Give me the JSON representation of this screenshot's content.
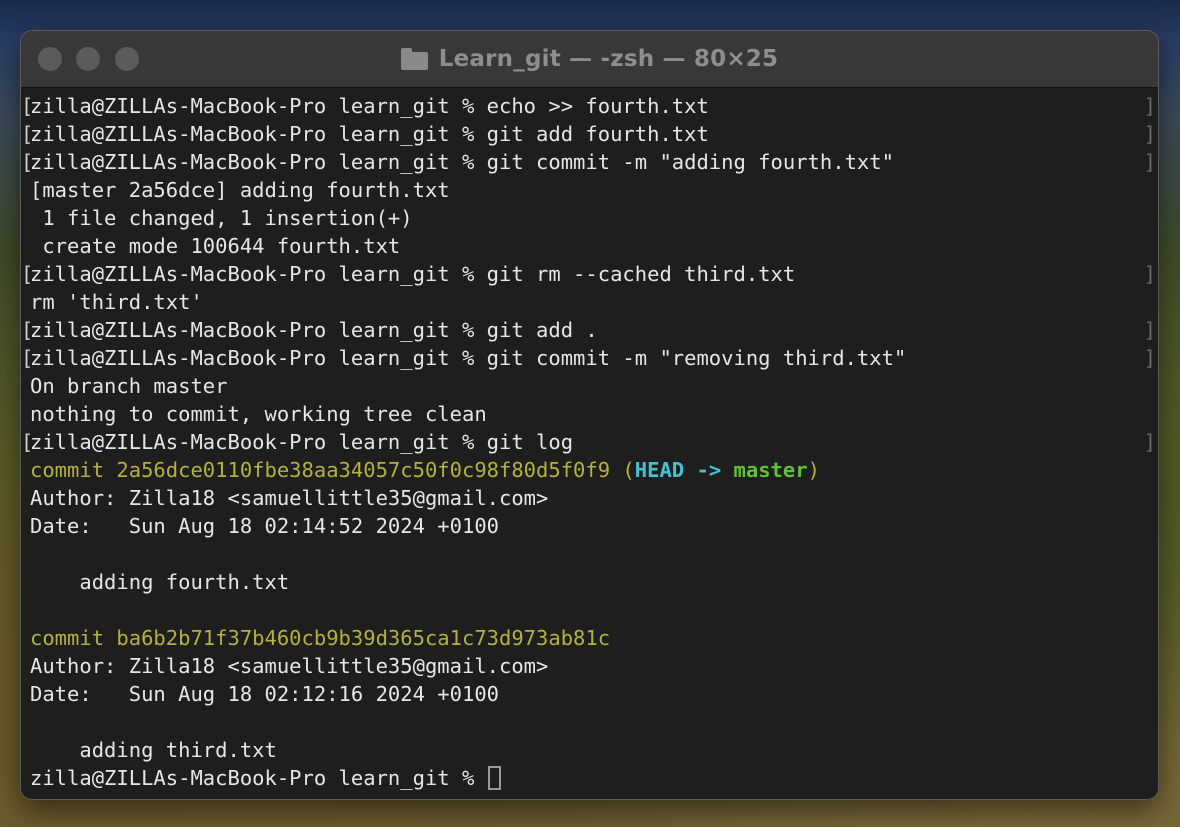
{
  "window": {
    "title": "Learn_git — -zsh — 80×25"
  },
  "terminal": {
    "lines": [
      {
        "kind": "prompt",
        "text": "zilla@ZILLAs-MacBook-Pro learn_git % echo >> fourth.txt"
      },
      {
        "kind": "prompt",
        "text": "zilla@ZILLAs-MacBook-Pro learn_git % git add fourth.txt"
      },
      {
        "kind": "prompt",
        "text": "zilla@ZILLAs-MacBook-Pro learn_git % git commit -m \"adding fourth.txt\""
      },
      {
        "kind": "output",
        "text": "[master 2a56dce] adding fourth.txt"
      },
      {
        "kind": "output",
        "text": " 1 file changed, 1 insertion(+)"
      },
      {
        "kind": "output",
        "text": " create mode 100644 fourth.txt"
      },
      {
        "kind": "prompt",
        "text": "zilla@ZILLAs-MacBook-Pro learn_git % git rm --cached third.txt"
      },
      {
        "kind": "output",
        "text": "rm 'third.txt'"
      },
      {
        "kind": "prompt",
        "text": "zilla@ZILLAs-MacBook-Pro learn_git % git add ."
      },
      {
        "kind": "prompt",
        "text": "zilla@ZILLAs-MacBook-Pro learn_git % git commit -m \"removing third.txt\""
      },
      {
        "kind": "output",
        "text": "On branch master"
      },
      {
        "kind": "output",
        "text": "nothing to commit, working tree clean"
      },
      {
        "kind": "prompt",
        "text": "zilla@ZILLAs-MacBook-Pro learn_git % git log"
      },
      {
        "kind": "commit",
        "text": "commit 2a56dce0110fbe38aa34057c50f0c98f80d5f0f9",
        "decor_open": " (",
        "head": "HEAD ->",
        "branch": " master",
        "decor_close": ")"
      },
      {
        "kind": "output",
        "text": "Author: Zilla18 <samuellittle35@gmail.com>"
      },
      {
        "kind": "output",
        "text": "Date:   Sun Aug 18 02:14:52 2024 +0100"
      },
      {
        "kind": "output",
        "text": ""
      },
      {
        "kind": "output",
        "text": "    adding fourth.txt"
      },
      {
        "kind": "output",
        "text": ""
      },
      {
        "kind": "commit",
        "text": "commit ba6b2b71f37b460cb9b39d365ca1c73d973ab81c"
      },
      {
        "kind": "output",
        "text": "Author: Zilla18 <samuellittle35@gmail.com>"
      },
      {
        "kind": "output",
        "text": "Date:   Sun Aug 18 02:12:16 2024 +0100"
      },
      {
        "kind": "output",
        "text": ""
      },
      {
        "kind": "output",
        "text": "    adding third.txt"
      },
      {
        "kind": "current",
        "text": "zilla@ZILLAs-MacBook-Pro learn_git % "
      }
    ],
    "prompt_mark_open": "[",
    "prompt_mark_close": "]"
  },
  "colors": {
    "commit_hash": "#b5b13c",
    "head_ref": "#42c2cf",
    "branch_ref": "#5fc23a",
    "terminal_bg": "#1e1e1e",
    "terminal_fg": "#e6e6e6"
  }
}
